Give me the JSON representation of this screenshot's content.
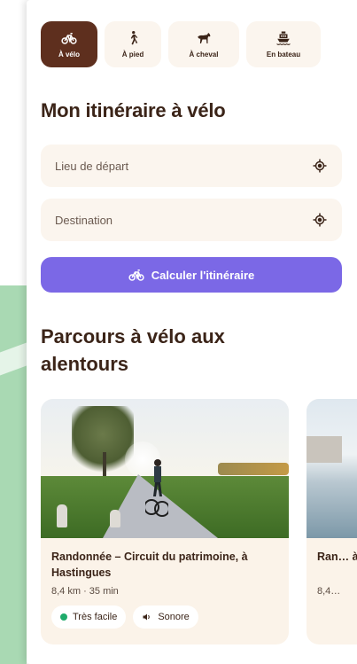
{
  "modes": [
    {
      "label": "À vélo",
      "icon": "bike-icon",
      "active": true
    },
    {
      "label": "À pied",
      "icon": "walker-icon",
      "active": false
    },
    {
      "label": "À cheval",
      "icon": "horse-icon",
      "active": false
    },
    {
      "label": "En bateau",
      "icon": "boat-icon",
      "active": false
    }
  ],
  "title": "Mon itinéraire à vélo",
  "departure": {
    "placeholder": "Lieu de départ"
  },
  "destination": {
    "placeholder": "Destination"
  },
  "calculate_label": "Calculer l'itinéraire",
  "section_title": "Parcours à vélo aux alentours",
  "cards": [
    {
      "title": "Randonnée – Circuit du patrimoine, à Hastingues",
      "meta": "8,4 km · 35 min",
      "tags": [
        {
          "label": "Très facile",
          "icon": "green-dot-icon"
        },
        {
          "label": "Sonore",
          "icon": "speaker-icon"
        }
      ]
    },
    {
      "title": "Ran… à H…",
      "meta": "8,4…",
      "tags": []
    }
  ],
  "colors": {
    "accent": "#7b68e6",
    "active_mode": "#5e2f1e",
    "field_bg": "#fbf5ee",
    "text": "#3b2418",
    "easy_dot": "#1fab6b"
  }
}
